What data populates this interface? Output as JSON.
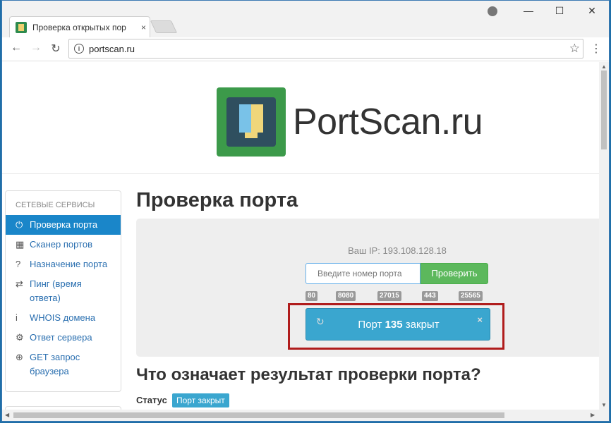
{
  "browser": {
    "tab_title": "Проверка открытых пор",
    "tab_close": "×",
    "url": "portscan.ru",
    "window_controls": {
      "minimize": "—",
      "maximize": "☐",
      "close": "✕"
    },
    "nav": {
      "back": "←",
      "forward": "→",
      "reload": "↻"
    },
    "star": "☆",
    "menu": "⋮",
    "info": "i"
  },
  "header": {
    "logo_text": "PortScan.ru"
  },
  "sidebar": {
    "heading": "СЕТЕВЫЕ СЕРВИСЫ",
    "items": [
      {
        "label": "Проверка порта",
        "icon": "⏻"
      },
      {
        "label": "Сканер портов",
        "icon": "▦"
      },
      {
        "label": "Назначение порта",
        "icon": "?"
      },
      {
        "label": "Пинг (время ответа)",
        "icon": "⇄"
      },
      {
        "label": "WHOIS домена",
        "icon": "i"
      },
      {
        "label": "Ответ сервера",
        "icon": "⚙"
      },
      {
        "label": "GET запрос браузера",
        "icon": "⊕"
      }
    ]
  },
  "main": {
    "title": "Проверка порта",
    "ip_text": "Ваш IP: 193.108.128.18",
    "input_placeholder": "Введите номер порта",
    "check_button": "Проверить",
    "quick_ports": [
      "80",
      "8080",
      "27015",
      "443",
      "25565"
    ],
    "result": {
      "prefix": "Порт ",
      "port": "135",
      "suffix": " закрыт",
      "refresh": "↻",
      "close": "×"
    },
    "subtitle": "Что означает результат проверки порта?",
    "status_label": "Статус",
    "status_badge": "Порт закрыт"
  },
  "colors": {
    "accent": "#1a86c9",
    "result_bg": "#3aa6cf",
    "check_btn": "#5cb85c",
    "highlight": "#b01c1c"
  }
}
